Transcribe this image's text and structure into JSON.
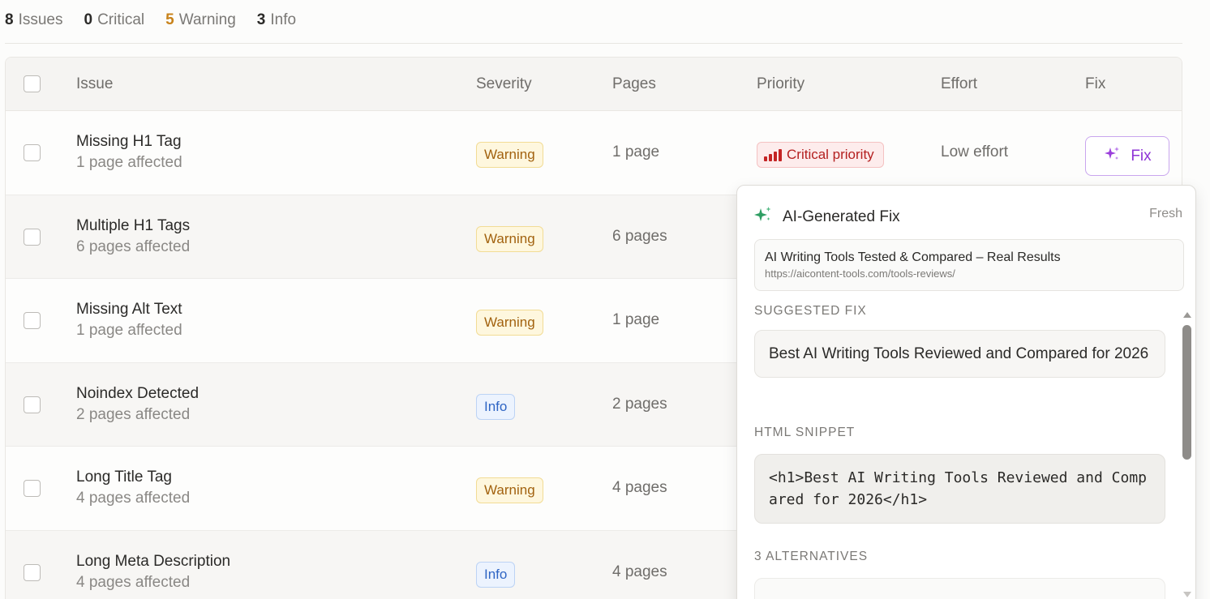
{
  "summary": {
    "issues": {
      "count": "8",
      "label": "Issues"
    },
    "critical": {
      "count": "0",
      "label": "Critical"
    },
    "warning": {
      "count": "5",
      "label": "Warning"
    },
    "info": {
      "count": "3",
      "label": "Info"
    }
  },
  "table": {
    "headers": {
      "issue": "Issue",
      "severity": "Severity",
      "pages": "Pages",
      "priority": "Priority",
      "effort": "Effort",
      "fix": "Fix"
    },
    "rows": [
      {
        "title": "Missing H1 Tag",
        "affected": "1 page affected",
        "severity": "Warning",
        "pages": "1 page",
        "priority": "Critical priority",
        "effort": "Low effort",
        "fix": "Fix"
      },
      {
        "title": "Multiple H1 Tags",
        "affected": "6 pages affected",
        "severity": "Warning",
        "pages": "6 pages"
      },
      {
        "title": "Missing Alt Text",
        "affected": "1 page affected",
        "severity": "Warning",
        "pages": "1 page"
      },
      {
        "title": "Noindex Detected",
        "affected": "2 pages affected",
        "severity": "Info",
        "pages": "2 pages"
      },
      {
        "title": "Long Title Tag",
        "affected": "4 pages affected",
        "severity": "Warning",
        "pages": "4 pages"
      },
      {
        "title": "Long Meta Description",
        "affected": "4 pages affected",
        "severity": "Info",
        "pages": "4 pages"
      }
    ]
  },
  "popover": {
    "title": "AI-Generated Fix",
    "status": "Fresh",
    "page_title": "AI Writing Tools Tested & Compared – Real Results",
    "page_url": "https://aicontent-tools.com/tools-reviews/",
    "suggested_label": "Suggested Fix",
    "suggested_text": "Best AI Writing Tools Reviewed and Compared for 2026",
    "html_label": "HTML Snippet",
    "html_snippet": "<h1>Best AI Writing Tools Reviewed and Compared for 2026</h1>",
    "alternatives_label": "3 Alternatives"
  },
  "colors": {
    "warning_count": "#c8821a",
    "critical_badge": "#b42020",
    "fix_accent": "#8e33d6",
    "sparkle_green": "#2f9e63"
  },
  "icons": {
    "fix_button": "sparkles-icon",
    "popover_header": "sparkles-icon",
    "priority": "signal-bars-icon"
  }
}
